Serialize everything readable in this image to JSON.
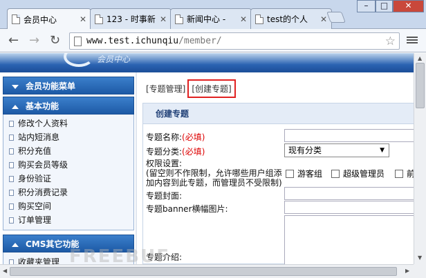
{
  "tabs": [
    {
      "title": "会员中心",
      "active": true
    },
    {
      "title": "123 - 时事新",
      "active": false
    },
    {
      "title": "新闻中心 - ",
      "active": false
    },
    {
      "title": "test的个人",
      "active": false
    }
  ],
  "window": {
    "min": "–",
    "max": "□",
    "close": "✕"
  },
  "toolbar": {
    "back": "←",
    "forward": "→",
    "reload": "↻",
    "url_host": "www.test.ichunqiu",
    "url_path": "/member/",
    "star": "☆"
  },
  "banner": {
    "logo_text": "会员中心"
  },
  "sidebar": {
    "menu_title": "会员功能菜单",
    "basic_title": "基本功能",
    "basic_items": [
      "修改个人资料",
      "站内短消息",
      "积分充值",
      "购买会员等级",
      "身份验证",
      "积分消费记录",
      "购买空间",
      "订单管理"
    ],
    "cms_title": "CMS其它功能",
    "cms_items": [
      "收藏夹管理"
    ]
  },
  "breadcrumb": {
    "item1": "[专题管理]",
    "item2": "[创建专题]"
  },
  "form": {
    "panel_title": "创建专题",
    "name_label": "专题名称:",
    "required": "(必填)",
    "category_label": "专题分类:",
    "category_value": "现有分类",
    "caret": "▼",
    "perm_label": "权限设置:",
    "perm_note1": "(留空则不作限制，允许哪些用户组添",
    "perm_note2": "加内容到此专题，而管理员不受限制)",
    "perm_options": [
      "游客组",
      "超级管理员",
      "前"
    ],
    "cover_label": "专题封面:",
    "banner_label": "专题banner横幅图片:",
    "intro_label": "专题介绍:"
  },
  "watermark": "FREEBUF"
}
